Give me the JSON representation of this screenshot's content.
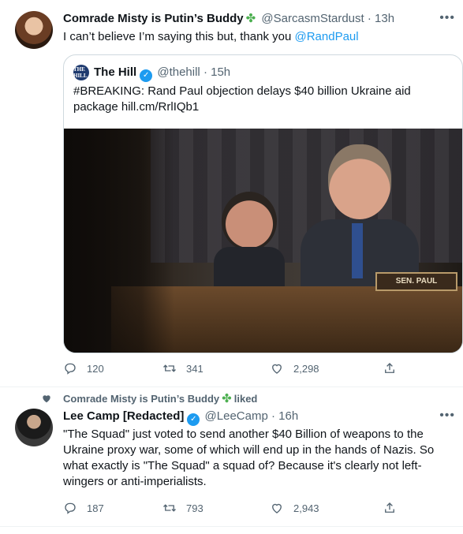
{
  "tweet1": {
    "display_name": "Comrade Misty is Putin’s Buddy",
    "clover": "✤",
    "handle": "@SarcasmStardust",
    "time": "· 13h",
    "text_prefix": "I can’t believe I’m saying this but, thank you ",
    "text_mention": "@RandPaul",
    "quote": {
      "logo_text": "THE HILL",
      "display_name": "The Hill",
      "handle": "@thehill",
      "time": "· 15h",
      "text": "#BREAKING: Rand Paul objection delays $40 billion Ukraine aid package hill.cm/RrlIQb1",
      "photo_plate": "SEN. PAUL"
    },
    "actions": {
      "replies": "120",
      "retweets": "341",
      "likes": "2,298"
    }
  },
  "tweet2": {
    "liked_by": "Comrade Misty is Putin’s Buddy",
    "liked_clover": "✤",
    "liked_suffix": "liked",
    "display_name": "Lee Camp [Redacted]",
    "handle": "@LeeCamp",
    "time": "· 16h",
    "text": "\"The Squad\" just voted to send another $40 Billion of weapons to the Ukraine proxy war, some of which will end up in the hands of Nazis. So what exactly is \"The Squad\" a squad of? Because it's clearly not left-wingers or anti-imperialists.",
    "actions": {
      "replies": "187",
      "retweets": "793",
      "likes": "2,943"
    }
  },
  "colors": {
    "accent": "#1d9bf0",
    "muted": "#536471",
    "border": "#cfd9de"
  },
  "icons": [
    "reply-icon",
    "retweet-icon",
    "like-icon",
    "share-icon",
    "more-icon",
    "verified-icon",
    "clover-icon"
  ]
}
